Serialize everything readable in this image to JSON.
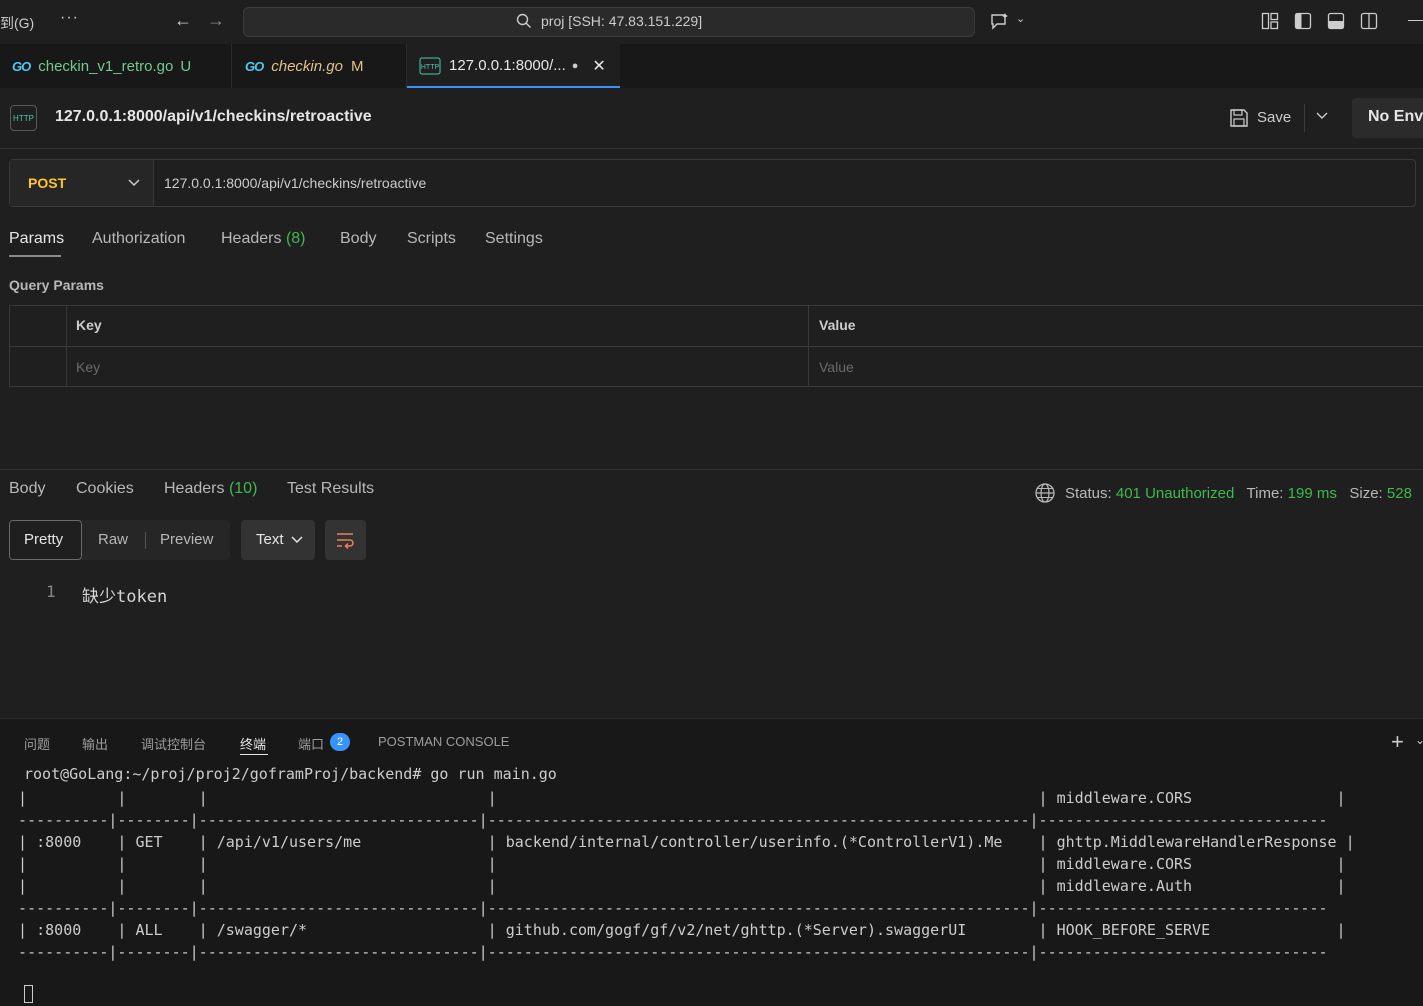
{
  "titlebar": {
    "menu_goto": "到(G)",
    "more": "···",
    "command_center": "proj [SSH: 47.83.151.229]"
  },
  "editor_tabs": [
    {
      "icon": "GO",
      "label": "checkin_v1_retro.go",
      "badge": "U"
    },
    {
      "icon": "GO",
      "label": "checkin.go",
      "badge": "M"
    },
    {
      "icon": "HTTP",
      "label": "127.0.0.1:8000/...",
      "dirty": "●",
      "close": "✕"
    }
  ],
  "request": {
    "title": "127.0.0.1:8000/api/v1/checkins/retroactive",
    "save_label": "Save",
    "environment": "No Envi",
    "method": "POST",
    "url": "127.0.0.1:8000/api/v1/checkins/retroactive",
    "tabs": {
      "params": "Params",
      "authorization": "Authorization",
      "headers": "Headers",
      "headers_count": "(8)",
      "body": "Body",
      "scripts": "Scripts",
      "settings": "Settings"
    },
    "query_params": {
      "label": "Query Params",
      "key_header": "Key",
      "value_header": "Value",
      "key_placeholder": "Key",
      "value_placeholder": "Value"
    }
  },
  "response": {
    "tabs": {
      "body": "Body",
      "cookies": "Cookies",
      "headers": "Headers",
      "headers_count": "(10)",
      "test_results": "Test Results"
    },
    "status_label": "Status:",
    "status_value": "401 Unauthorized",
    "time_label": "Time:",
    "time_value": "199 ms",
    "size_label": "Size:",
    "size_value": "528",
    "view_modes": {
      "pretty": "Pretty",
      "raw": "Raw",
      "preview": "Preview"
    },
    "format": "Text",
    "body_lines": [
      {
        "no": "1",
        "text": "缺少token"
      }
    ]
  },
  "panel": {
    "tabs": {
      "problems": "问题",
      "output": "输出",
      "debug_console": "调试控制台",
      "terminal": "终端",
      "ports": "端口",
      "ports_count": "2",
      "postman_console": "POSTMAN CONSOLE"
    },
    "terminal_lines": [
      "root@GoLang:~/proj/proj2/goframProj/backend# go run main.go",
      "  |          |        |                               |                                                            | middleware.CORS                |",
      "  ----------|--------|-------------------------------|------------------------------------------------------------|--------------------------------",
      "  | :8000    | GET    | /api/v1/users/me              | backend/internal/controller/userinfo.(*ControllerV1).Me    | ghttp.MiddlewareHandlerResponse |",
      "  |          |        |                               |                                                            | middleware.CORS                |",
      "  |          |        |                               |                                                            | middleware.Auth                |",
      "  ----------|--------|-------------------------------|------------------------------------------------------------|--------------------------------",
      "  | :8000    | ALL    | /swagger/*                    | github.com/gogf/gf/v2/net/ghttp.(*Server).swaggerUI        | HOOK_BEFORE_SERVE              |",
      "  ----------|--------|-------------------------------|------------------------------------------------------------|--------------------------------"
    ]
  },
  "colors": {
    "accent": "#3794ff",
    "method_post": "#ffc62b",
    "status_ok_green": "#3fb950",
    "go_icon": "#4ec9f0",
    "untracked_green": "#73c991",
    "modified_yellow": "#e2c08d",
    "wrap_orange": "#e8825a"
  },
  "icons": {
    "back": "arrow-left-icon",
    "forward": "arrow-right-icon",
    "search": "search-icon",
    "copilot": "chat-sparkle-icon",
    "save": "floppy-disk-icon",
    "globe": "globe-icon",
    "wrap": "wrap-lines-icon",
    "plus": "plus-icon"
  }
}
